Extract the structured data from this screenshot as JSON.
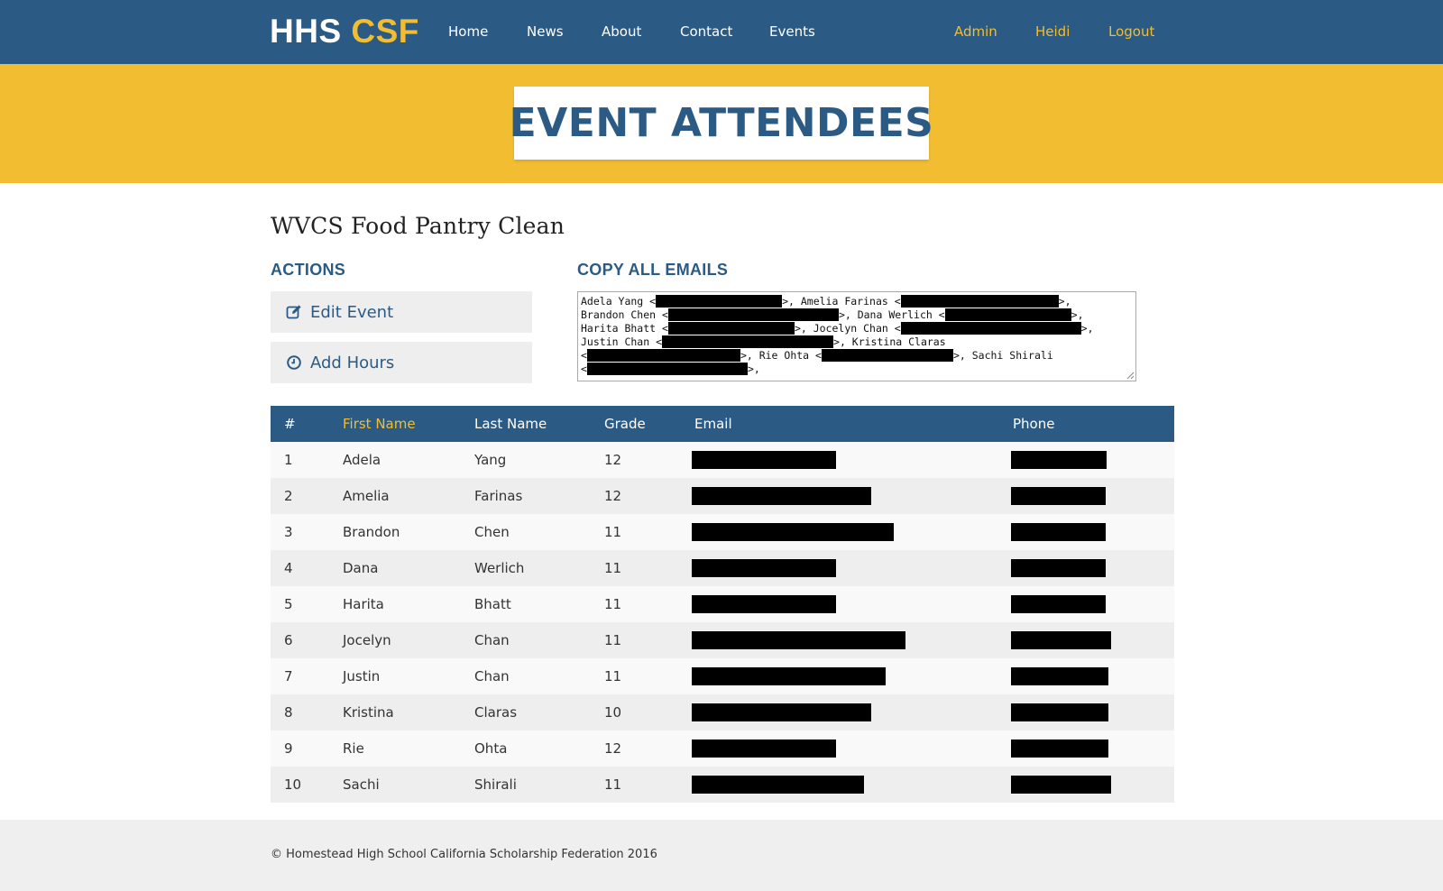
{
  "brand": {
    "part1": "HHS",
    "part2": "CSF"
  },
  "nav": {
    "left": [
      "Home",
      "News",
      "About",
      "Contact",
      "Events"
    ],
    "right": [
      "Admin",
      "Heidi",
      "Logout"
    ]
  },
  "colors": {
    "primary": "#2b5b84",
    "accent": "#f2bd31",
    "redaction": "#000000"
  },
  "hero": {
    "title": "EVENT ATTENDEES"
  },
  "event": {
    "title": "WVCS Food Pantry Clean"
  },
  "actions": {
    "heading": "ACTIONS",
    "edit_label": "Edit Event",
    "edit_icon": "edit-icon",
    "hours_label": "Add Hours",
    "hours_icon": "clock-icon"
  },
  "emails": {
    "heading": "COPY ALL EMAILS",
    "lines": [
      [
        "Adela Yang <",
        ">, Amelia Farinas <",
        ">,"
      ],
      [
        "Brandon Chen <",
        ">, Dana Werlich <",
        ">,"
      ],
      [
        "Harita Bhatt <",
        ">, Jocelyn Chan <",
        ">,"
      ],
      [
        "Justin Chan <",
        ">, Kristina Claras"
      ],
      [
        "<",
        ">, Rie Ohta <",
        ">, Sachi Shirali"
      ],
      [
        "<",
        ">,"
      ]
    ]
  },
  "table": {
    "columns": [
      "#",
      "First Name",
      "Last Name",
      "Grade",
      "Email",
      "Phone"
    ],
    "sorted_column": "First Name",
    "rows": [
      {
        "num": "1",
        "first": "Adela",
        "last": "Yang",
        "grade": "12"
      },
      {
        "num": "2",
        "first": "Amelia",
        "last": "Farinas",
        "grade": "12"
      },
      {
        "num": "3",
        "first": "Brandon",
        "last": "Chen",
        "grade": "11"
      },
      {
        "num": "4",
        "first": "Dana",
        "last": "Werlich",
        "grade": "11"
      },
      {
        "num": "5",
        "first": "Harita",
        "last": "Bhatt",
        "grade": "11"
      },
      {
        "num": "6",
        "first": "Jocelyn",
        "last": "Chan",
        "grade": "11"
      },
      {
        "num": "7",
        "first": "Justin",
        "last": "Chan",
        "grade": "11"
      },
      {
        "num": "8",
        "first": "Kristina",
        "last": "Claras",
        "grade": "10"
      },
      {
        "num": "9",
        "first": "Rie",
        "last": "Ohta",
        "grade": "12"
      },
      {
        "num": "10",
        "first": "Sachi",
        "last": "Shirali",
        "grade": "11"
      }
    ]
  },
  "footer": {
    "text": "© Homestead High School California Scholarship Federation 2016"
  }
}
